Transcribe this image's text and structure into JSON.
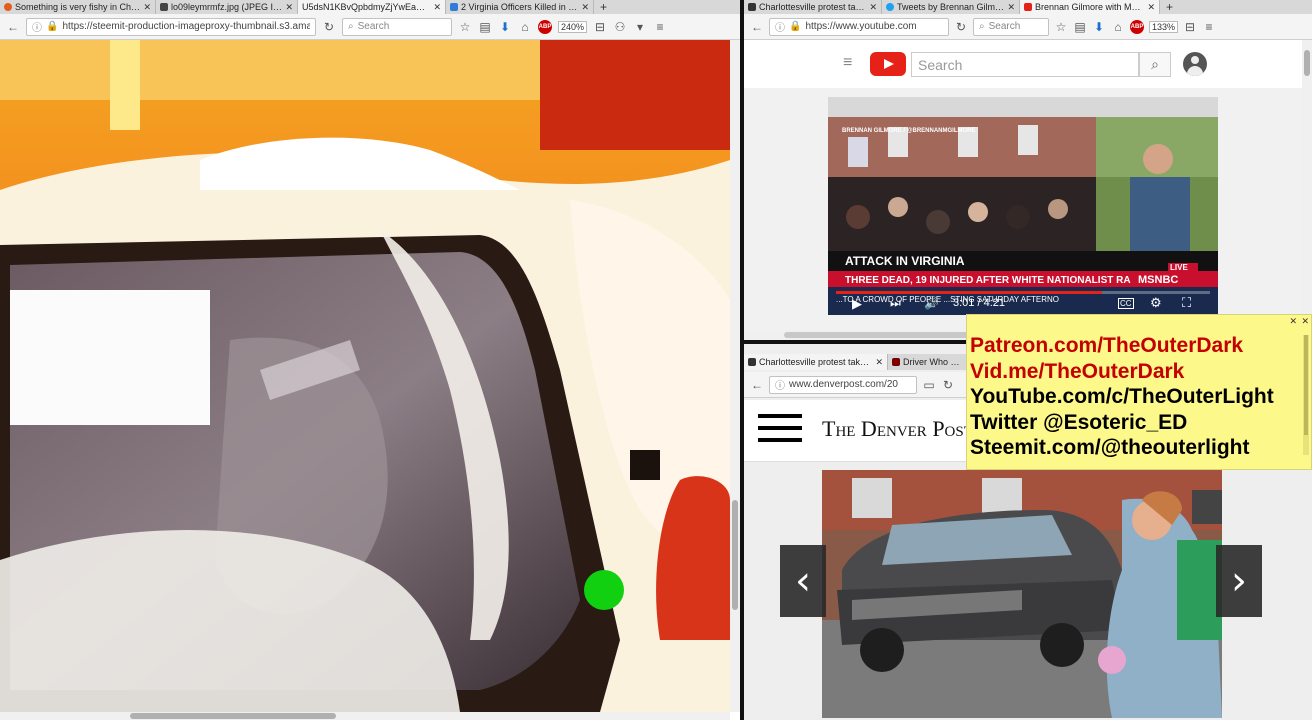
{
  "left": {
    "tabs": [
      {
        "title": "Something is very fishy in Cha...",
        "active": false,
        "color": "#e55b1e"
      },
      {
        "title": "lo09leymrmfz.jpg (JPEG Imag...",
        "active": false,
        "color": "#444444"
      },
      {
        "title": "U5dsN1KBvQpbdmyZjYwEaKmya...",
        "active": true,
        "color": "#bbbbbb"
      },
      {
        "title": "2 Virginia Officers Killed in Hel...",
        "active": false,
        "color": "#2f7bd9"
      }
    ],
    "url": "https://steemit-production-imageproxy-thumbnail.s3.ama",
    "search_placeholder": "Search",
    "zoom": "240%"
  },
  "top_right": {
    "tabs": [
      {
        "title": "Charlottesville protest takes ...",
        "active": false,
        "color": "#333333"
      },
      {
        "title": "Tweets by Brennan Gilmore ...",
        "active": false,
        "color": "#1da1f2"
      },
      {
        "title": "Brennan Gilmore with MSN...",
        "active": true,
        "color": "#e62117"
      }
    ],
    "url": "https://www.youtube.com",
    "search_placeholder": "Search",
    "zoom": "133%",
    "youtube": {
      "search_placeholder": "Search",
      "video": {
        "lower_third": "ATTACK IN VIRGINIA",
        "ticker": "THREE DEAD, 19 INJURED AFTER WHITE NATIONALIST RALLY",
        "crawl": "...TO A CROWD OF PEOPLE ...STING SATURDAY AFTERNO",
        "live_badge": "LIVE",
        "network": "MSNBC",
        "name_tag": "BRENNAN GILMORE / @BRENNANMGILMORE",
        "time": "3:01 / 4:21",
        "cc": "CC"
      }
    }
  },
  "bottom_right": {
    "tabs": [
      {
        "title": "Charlottesville protest takes a ...",
        "active": true,
        "color": "#333333"
      },
      {
        "title": "Driver Who Pl...",
        "active": false,
        "color": "#7a0000"
      }
    ],
    "url": "www.denverpost.com/20",
    "masthead": "The Denver Post"
  },
  "overlay": {
    "lines": [
      {
        "text": "Patreon.com/TheOuterDark",
        "color": "#c40000"
      },
      {
        "text": "Vid.me/TheOuterDark",
        "color": "#c40000"
      },
      {
        "text": "YouTube.com/c/TheOuterLight",
        "color": "#000000"
      },
      {
        "text": "Twitter @Esoteric_ED",
        "color": "#000000"
      },
      {
        "text": "Steemit.com/@theouterlight",
        "color": "#000000"
      }
    ],
    "background": "#fdf88a"
  }
}
